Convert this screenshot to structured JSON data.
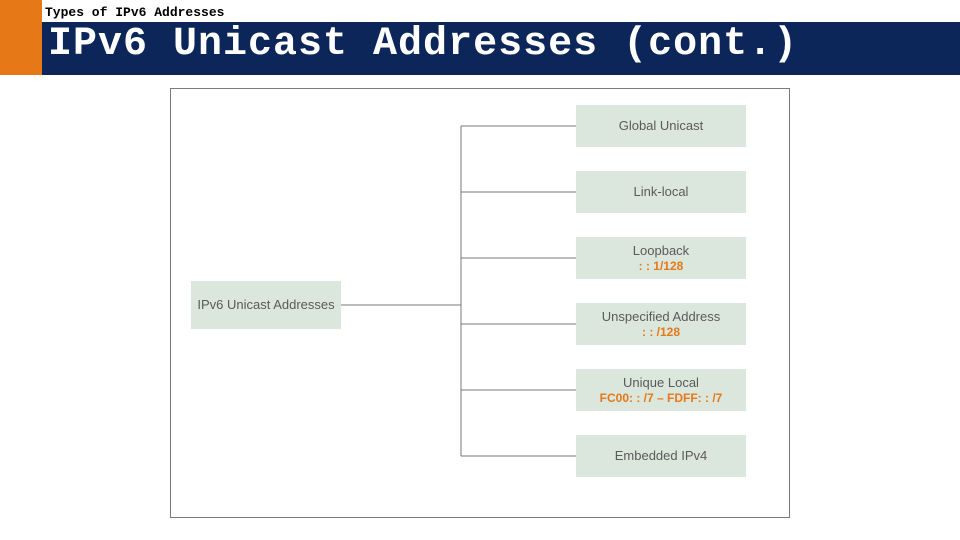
{
  "header": {
    "breadcrumb": "Types of IPv6 Addresses",
    "title": "IPv6 Unicast Addresses (cont.)"
  },
  "diagram": {
    "root": {
      "label": "IPv6 Unicast Addresses"
    },
    "children": [
      {
        "label": "Global Unicast",
        "sub": ""
      },
      {
        "label": "Link-local",
        "sub": ""
      },
      {
        "label": "Loopback",
        "sub": ": : 1/128"
      },
      {
        "label": "Unspecified Address",
        "sub": ": : /128"
      },
      {
        "label": "Unique Local",
        "sub": "FC00: : /7 – FDFF: : /7"
      },
      {
        "label": "Embedded IPv4",
        "sub": ""
      }
    ]
  }
}
